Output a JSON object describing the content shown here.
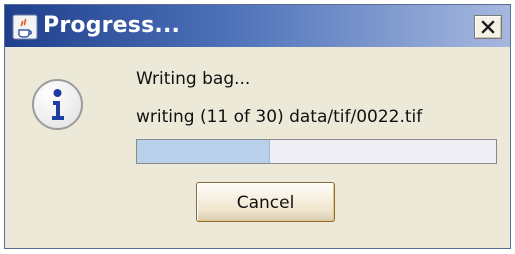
{
  "window": {
    "title": "Progress...",
    "icons": {
      "app": "java-cup-icon",
      "close": "close-icon",
      "info": "info-icon"
    }
  },
  "dialog": {
    "message": "Writing bag...",
    "detail": "writing (11 of 30) data/tif/0022.tif",
    "progress": {
      "current": 11,
      "total": 30,
      "fraction": 0.367
    },
    "cancel_label": "Cancel"
  }
}
